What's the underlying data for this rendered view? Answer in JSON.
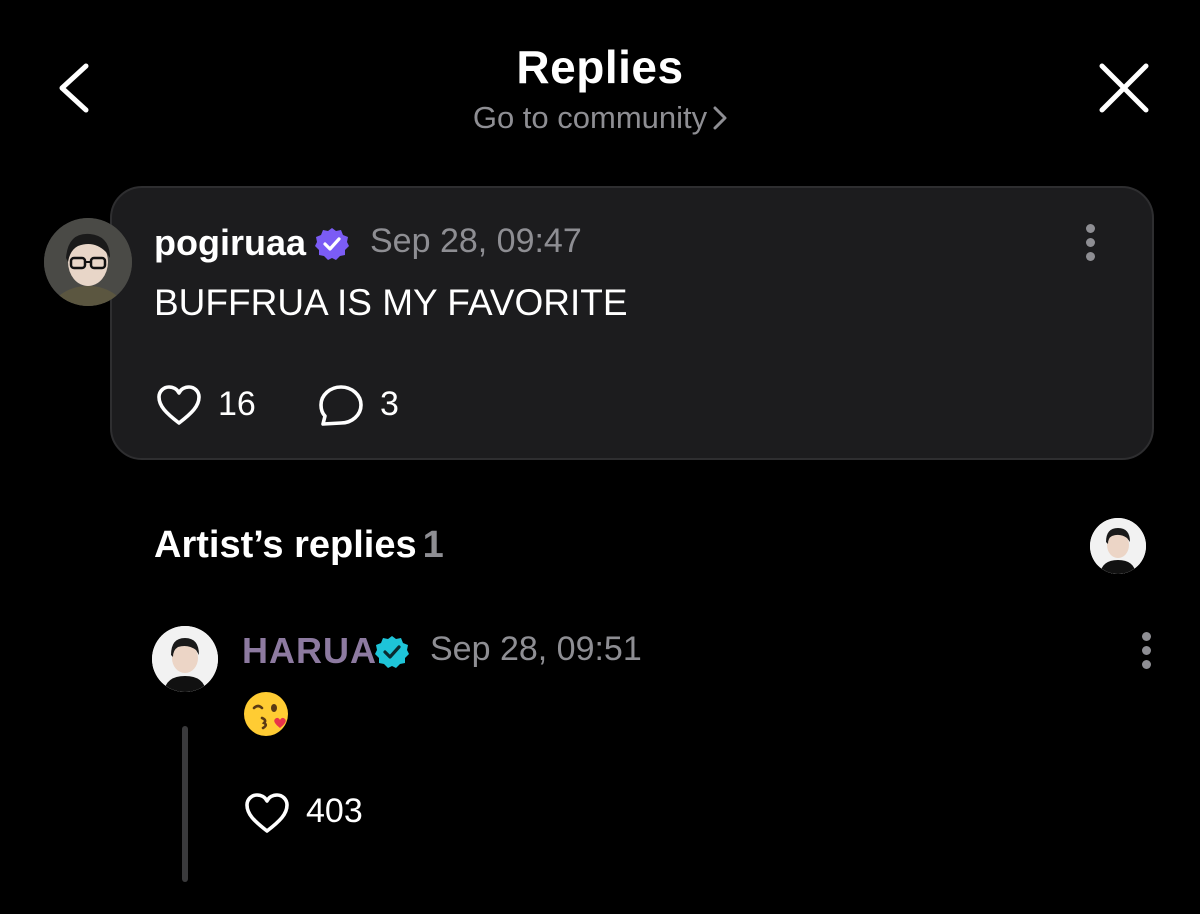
{
  "header": {
    "title": "Replies",
    "subtitle": "Go to community",
    "back_icon": "chevron-left-icon",
    "close_icon": "close-icon"
  },
  "post": {
    "username": "pogiruaa",
    "timestamp": "Sep 28, 09:47",
    "text": "BUFFRUA IS MY FAVORITE",
    "likes": "16",
    "comments": "3",
    "badge_color": "#7b5cf5"
  },
  "artist_replies": {
    "title": "Artist’s replies",
    "count": "1",
    "reply": {
      "username": "HARUA",
      "timestamp": "Sep 28, 09:51",
      "emoji": "face-blowing-a-kiss",
      "likes": "403",
      "badge_color": "#1ec4d8",
      "name_color": "#8d7aa0"
    }
  }
}
